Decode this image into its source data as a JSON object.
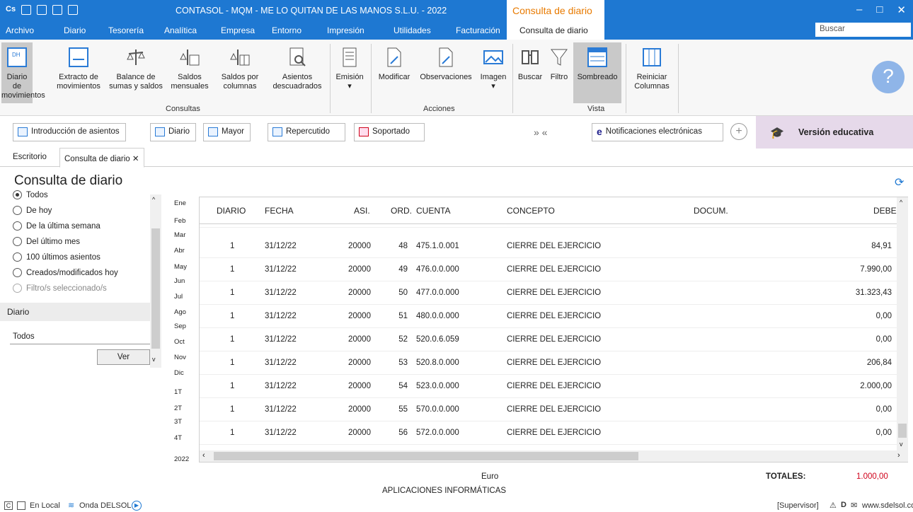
{
  "titlebar": {
    "title": "CONTASOL - MQM - ME LO QUITAN DE LAS MANOS S.L.U. - 2022",
    "context_tab": "Consulta de diario",
    "controls": [
      "–",
      "□",
      "✕"
    ]
  },
  "menu": {
    "items": [
      "Archivo",
      "Diario",
      "Tesorería",
      "Analítica",
      "Empresa",
      "Entorno",
      "Impresión",
      "Utilidades",
      "Facturación"
    ],
    "active": "Consulta de diario",
    "search_placeholder": "Buscar"
  },
  "ribbon": {
    "consultas": [
      {
        "label1": "Diario de",
        "label2": "movimientos",
        "icon": "journal-icon",
        "selected": true
      },
      {
        "label1": "Extracto de",
        "label2": "movimientos",
        "icon": "extract-icon"
      },
      {
        "label1": "Balance de",
        "label2": "sumas y saldos",
        "icon": "scale-icon"
      },
      {
        "label1": "Saldos",
        "label2": "mensuales",
        "icon": "scale-calendar-icon"
      },
      {
        "label1": "Saldos por",
        "label2": "columnas",
        "icon": "scale-columns-icon"
      },
      {
        "label1": "Asientos",
        "label2": "descuadrados",
        "icon": "unbalanced-entries-icon"
      }
    ],
    "consultas_label": "Consultas",
    "emision": "Emisión",
    "acciones": [
      "Modificar",
      "Observaciones",
      "Imagen"
    ],
    "acciones_label": "Acciones",
    "vista": [
      "Buscar",
      "Filtro",
      "Sombreado"
    ],
    "vista_label": "Vista",
    "reiniciar1": "Reiniciar",
    "reiniciar2": "Columnas"
  },
  "shortcuts": {
    "items": [
      "Introducción de asientos",
      "Diario",
      "Mayor",
      "Repercutido",
      "Soportado"
    ],
    "arrows": "» «",
    "notificaciones": "Notificaciones electrónicas",
    "version": "Versión educativa"
  },
  "tabs": {
    "escritorio": "Escritorio",
    "active": "Consulta de diario ✕"
  },
  "page_title": "Consulta de diario",
  "filters": {
    "options": [
      {
        "label": "Todos",
        "checked": true
      },
      {
        "label": "De hoy"
      },
      {
        "label": "De la última semana"
      },
      {
        "label": "Del último mes"
      },
      {
        "label": "100 últimos asientos"
      },
      {
        "label": "Creados/modificados hoy"
      },
      {
        "label": "Filtro/s seleccionado/s",
        "disabled": true
      }
    ],
    "diario_header": "Diario",
    "diario_value": "Todos",
    "ver_button": "Ver"
  },
  "months": [
    "Ene",
    "Feb",
    "Mar",
    "Abr",
    "May",
    "Jun",
    "Jul",
    "Ago",
    "Sep",
    "Oct",
    "Nov",
    "Dic",
    "1T",
    "2T",
    "3T",
    "4T"
  ],
  "year": "2022",
  "table": {
    "columns": [
      "DIARIO",
      "FECHA",
      "ASI.",
      "ORD.",
      "CUENTA",
      "CONCEPTO",
      "DOCUM.",
      "DEBE"
    ],
    "rows": [
      [
        "1",
        "31/12/22",
        "20000",
        "48",
        "475.1.0.001",
        "CIERRE DEL EJERCICIO",
        "",
        "84,91"
      ],
      [
        "1",
        "31/12/22",
        "20000",
        "49",
        "476.0.0.000",
        "CIERRE DEL EJERCICIO",
        "",
        "7.990,00"
      ],
      [
        "1",
        "31/12/22",
        "20000",
        "50",
        "477.0.0.000",
        "CIERRE DEL EJERCICIO",
        "",
        "31.323,43"
      ],
      [
        "1",
        "31/12/22",
        "20000",
        "51",
        "480.0.0.000",
        "CIERRE DEL EJERCICIO",
        "",
        "0,00"
      ],
      [
        "1",
        "31/12/22",
        "20000",
        "52",
        "520.0.6.059",
        "CIERRE DEL EJERCICIO",
        "",
        "0,00"
      ],
      [
        "1",
        "31/12/22",
        "20000",
        "53",
        "520.8.0.000",
        "CIERRE DEL EJERCICIO",
        "",
        "206,84"
      ],
      [
        "1",
        "31/12/22",
        "20000",
        "54",
        "523.0.0.000",
        "CIERRE DEL EJERCICIO",
        "",
        "2.000,00"
      ],
      [
        "1",
        "31/12/22",
        "20000",
        "55",
        "570.0.0.000",
        "CIERRE DEL EJERCICIO",
        "",
        "0,00"
      ],
      [
        "1",
        "31/12/22",
        "20000",
        "56",
        "572.0.0.000",
        "CIERRE DEL EJERCICIO",
        "",
        "0,00"
      ]
    ]
  },
  "footer": {
    "currency": "Euro",
    "company": "APLICACIONES INFORMÁTICAS",
    "totales_label": "TOTALES:",
    "totales_value": "1.000,00"
  },
  "status": {
    "en_local": "En Local",
    "onda": "Onda DELSOL",
    "user": "[Supervisor]",
    "web": "www.sdelsol.com"
  },
  "colors": {
    "accent": "#1e78d2",
    "context": "#e87a00",
    "total": "#d0021b"
  }
}
